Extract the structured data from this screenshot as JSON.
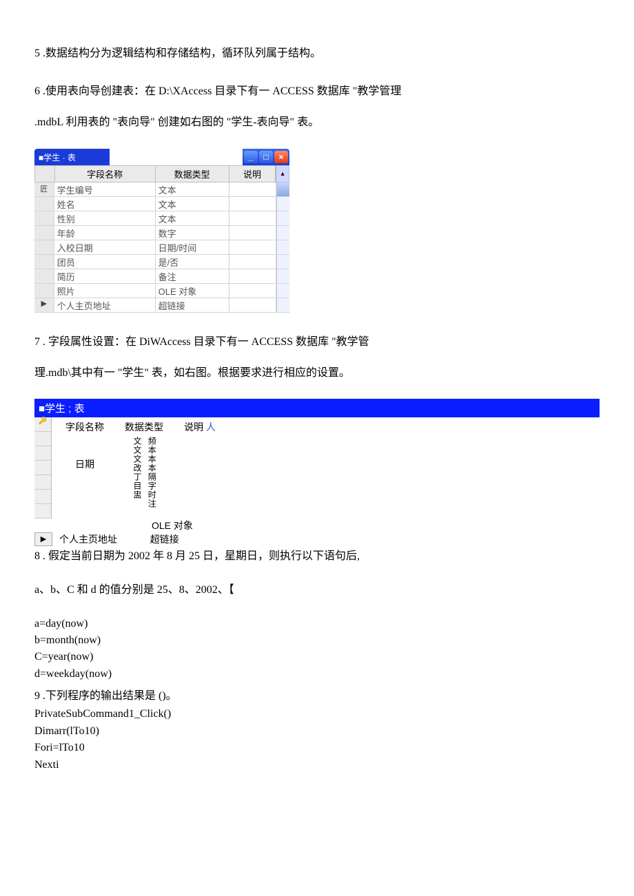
{
  "q5": {
    "text": "5  .数据结构分为逻辑结构和存储结构，循环队列属于结构。"
  },
  "q6": {
    "line1": "6  .使用表向导创建表：在 D:\\XAccess 目录下有一 ACCESS 数据库 \"教学管理",
    "line2": ".mdbL 利用表的 \"表向导\" 创建如右图的 \"学生-表向导\" 表。"
  },
  "table1": {
    "title_left": "■学生 · 表",
    "headers": {
      "name": "字段名称",
      "type": "数据类型",
      "desc": "说明"
    },
    "rows": [
      {
        "sel": "匠",
        "name": "学生编号",
        "type": "文本",
        "desc": ""
      },
      {
        "sel": "",
        "name": "姓名",
        "type": "文本",
        "desc": ""
      },
      {
        "sel": "",
        "name": "性别",
        "type": "文本",
        "desc": ""
      },
      {
        "sel": "",
        "name": "年龄",
        "type": "数字",
        "desc": ""
      },
      {
        "sel": "",
        "name": "入校日期",
        "type": "日期/时间",
        "desc": ""
      },
      {
        "sel": "",
        "name": "团员",
        "type": "是/否",
        "desc": ""
      },
      {
        "sel": "",
        "name": "简历",
        "type": "备注",
        "desc": ""
      },
      {
        "sel": "",
        "name": "照片",
        "type": "OLE 对象",
        "desc": ""
      },
      {
        "sel": "▶",
        "name": "个人主页地址",
        "type": "超链接",
        "desc": ""
      }
    ]
  },
  "q7": {
    "line1": "7  . 字段属性设置：在 DiWAccess 目录下有一 ACCESS 数据库 \"教学管",
    "line2": "理.mdb\\其中有一 \"学生\" 表，如右图。根据要求进行相应的设置。"
  },
  "table2": {
    "title": "■学生 ; 表",
    "headers": {
      "name": "字段名称",
      "type": "数据类型",
      "desc": "说明",
      "desc2": "人"
    },
    "left_vertical": "日期",
    "mid_vertical": "文文文改丁目盅",
    "right_vertical": "频本本本隔字时注",
    "bottom_type1": "OLE 对象",
    "bottom_name": "个人主页地址",
    "bottom_type2": "超链接",
    "key_icon": "🔑"
  },
  "q8": {
    "line1": "8  . 假定当前日期为 2002 年 8 月 25 日，星期日，则执行以下语句后,",
    "line2": "a、b、C 和 d 的值分别是 25、8、2002、【",
    "code": [
      "a=day(now)",
      "b=month(now)",
      "C=year(now)",
      "d=weekday(now)"
    ]
  },
  "q9": {
    "line1": "9  .下列程序的输出结果是 ()。",
    "code": [
      "PrivateSubCommand1_Click()",
      "Dimarr(lTo10)",
      "Fori=lTo10",
      "Nexti"
    ]
  }
}
